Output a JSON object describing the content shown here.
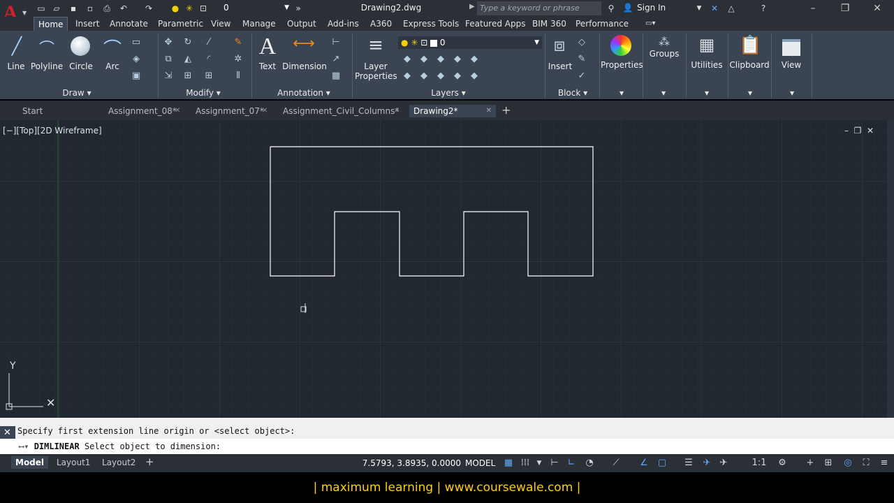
{
  "title_bar": {
    "layer_combo_value": "0",
    "document_title": "Drawing2.dwg",
    "search_placeholder": "Type a keyword or phrase",
    "sign_in_label": "Sign In"
  },
  "ribbon_tabs": [
    "Home",
    "Insert",
    "Annotate",
    "Parametric",
    "View",
    "Manage",
    "Output",
    "Add-ins",
    "A360",
    "Express Tools",
    "Featured Apps",
    "BIM 360",
    "Performance"
  ],
  "ribbon": {
    "draw": {
      "title": "Draw",
      "tools": [
        "Line",
        "Polyline",
        "Circle",
        "Arc"
      ]
    },
    "modify": {
      "title": "Modify"
    },
    "annotation": {
      "title": "Annotation",
      "tools": [
        "Text",
        "Dimension"
      ]
    },
    "layers": {
      "title": "Layers",
      "tool_line1": "Layer",
      "tool_line2": "Properties",
      "layer_value": "0"
    },
    "block": {
      "title": "Block",
      "tool": "Insert"
    },
    "properties": "Properties",
    "groups": "Groups",
    "utilities": "Utilities",
    "clipboard": "Clipboard",
    "view": "View"
  },
  "file_tabs": [
    "Start",
    "Assignment_08*",
    "Assignment_07*",
    "Assignment_Civil_Columns*",
    "Drawing2*"
  ],
  "viewport": {
    "label": "[−][Top][2D Wireframe]"
  },
  "command_line": {
    "history": "Specify first extension line origin or <select object>:",
    "command": "DIMLINEAR",
    "prompt": "Select object to dimension:"
  },
  "layout_tabs": [
    "Model",
    "Layout1",
    "Layout2"
  ],
  "status_bar": {
    "coordinates": "7.5793, 3.8935, 0.0000",
    "space": "MODEL",
    "scale": "1:1"
  },
  "footer": "| maximum learning | www.coursewale.com |",
  "colors": {
    "canvas": "#212830",
    "ribbon": "#3b4452",
    "titlebar": "#2b2f36",
    "accent": "#d0212a",
    "footer_text": "#ffd000"
  }
}
